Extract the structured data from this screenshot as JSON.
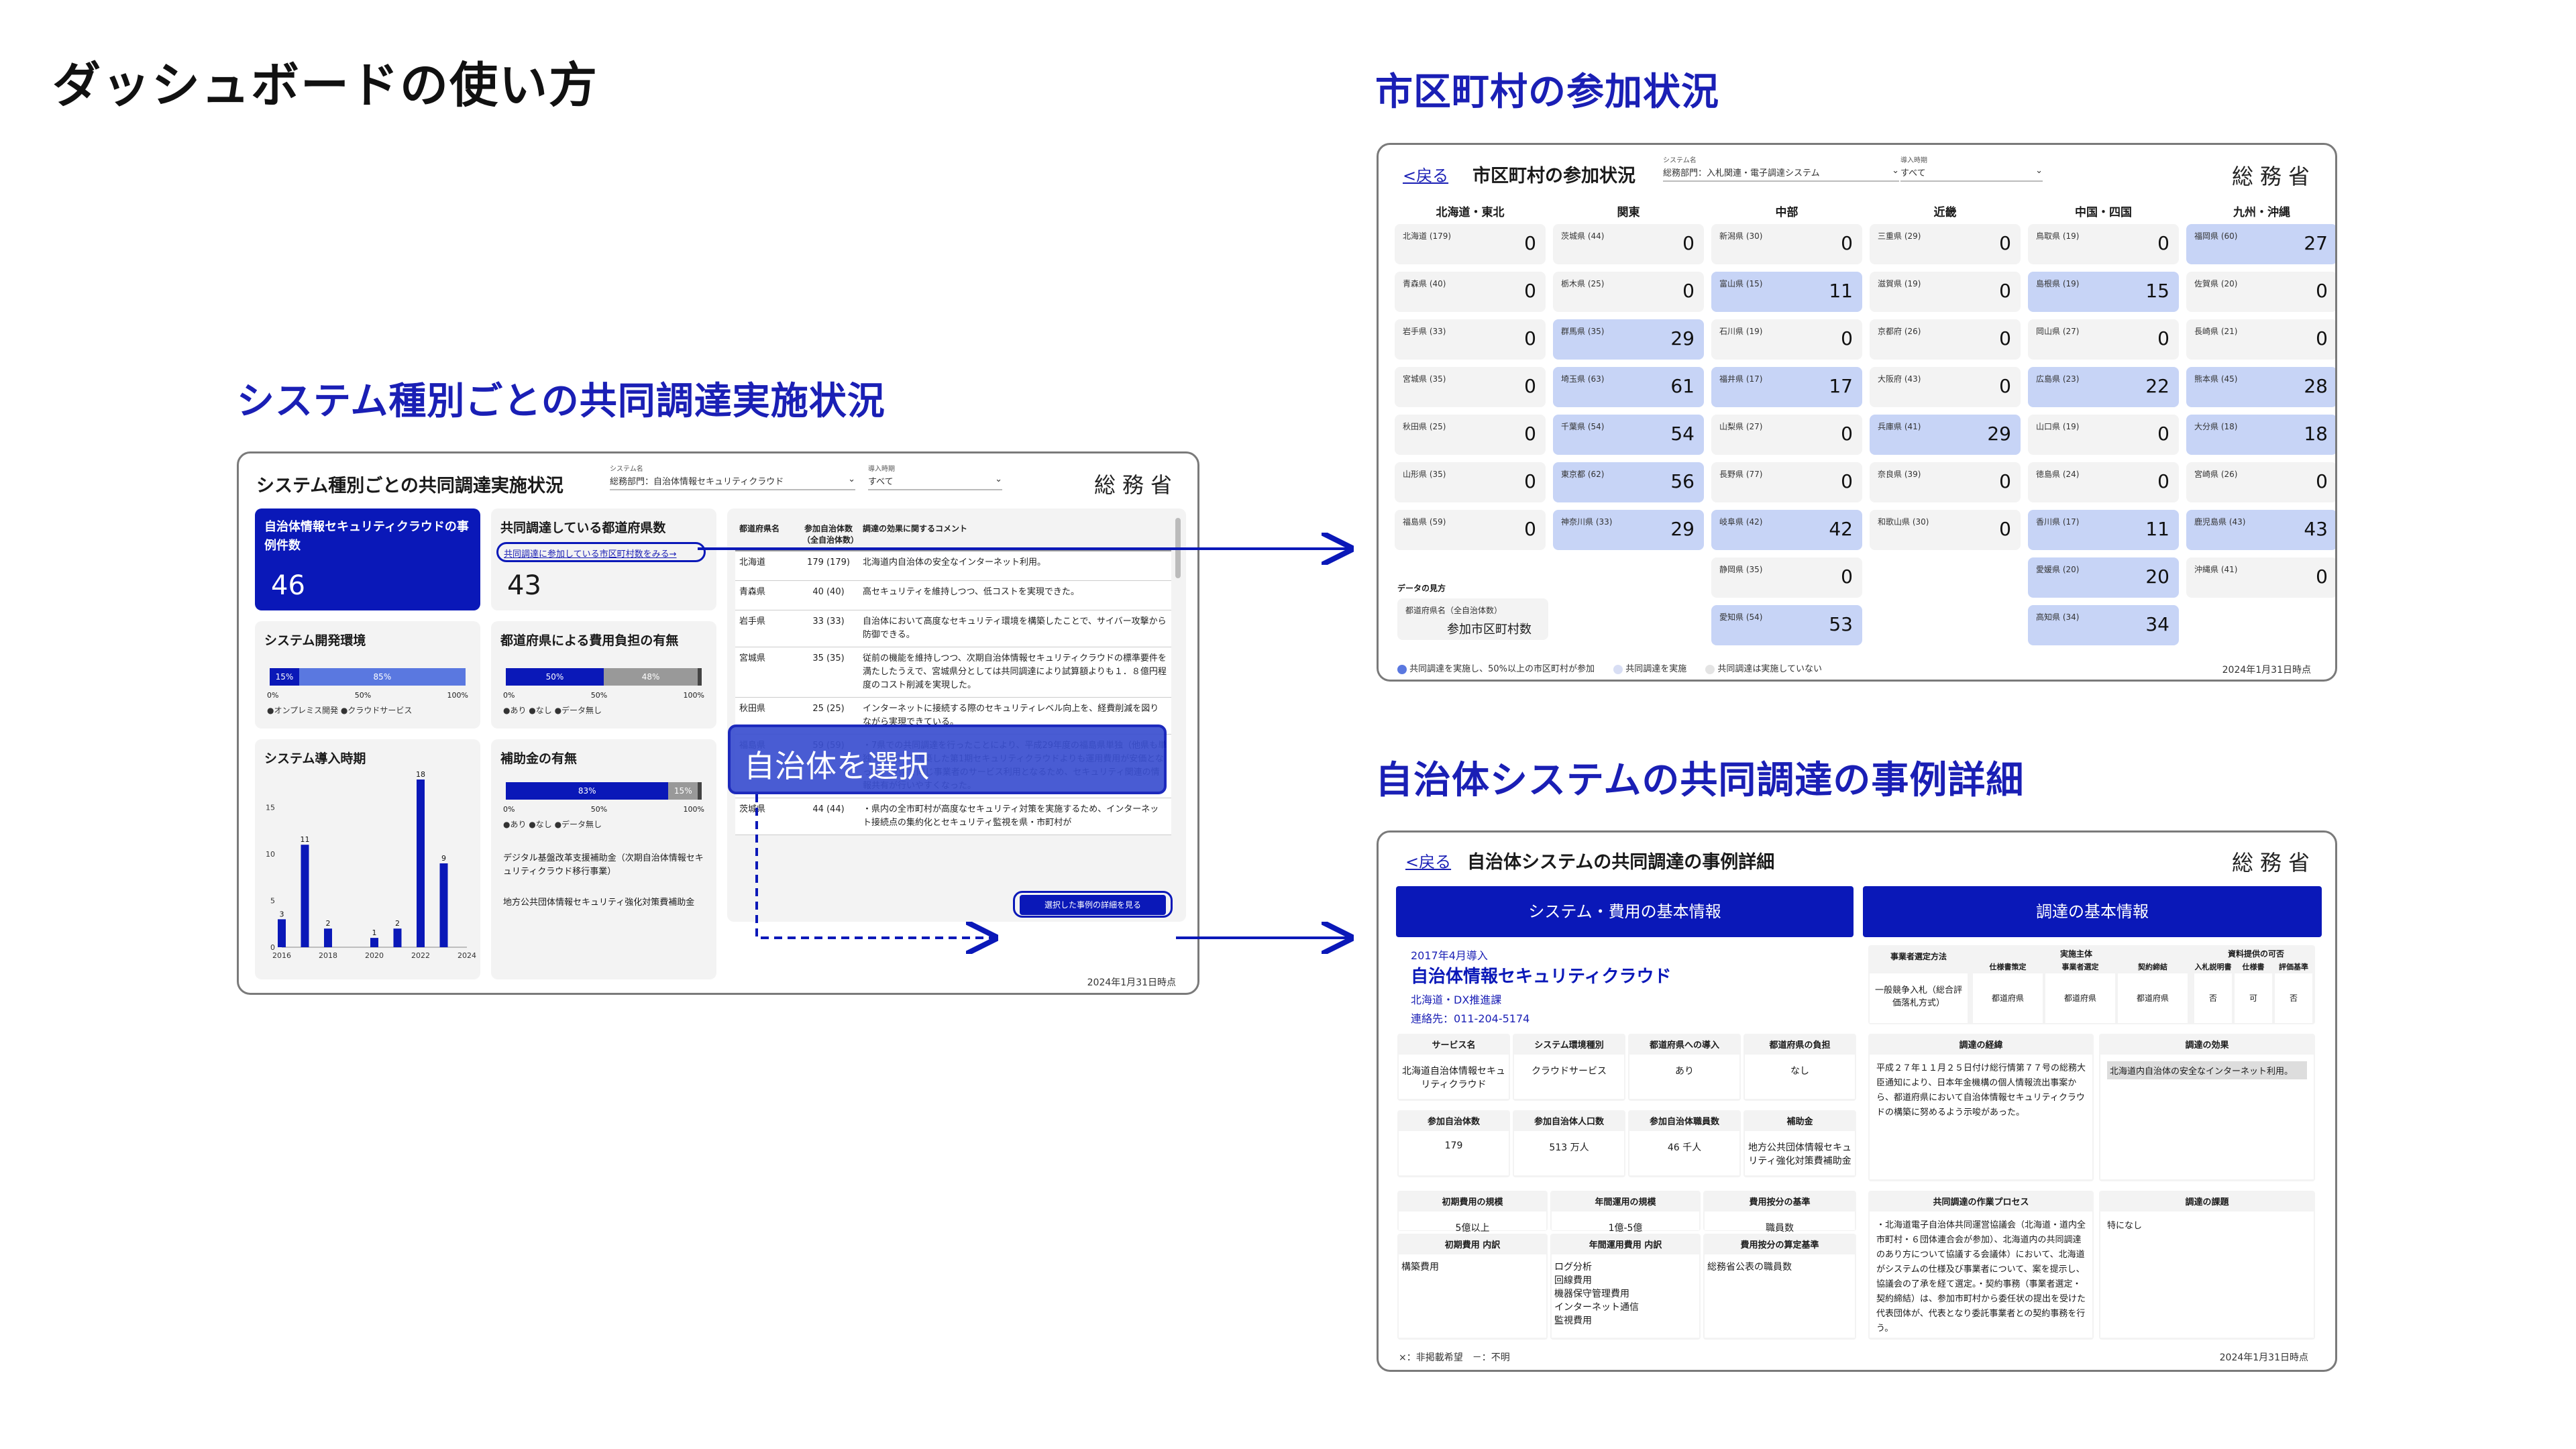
{
  "page_title": "ダッシュボードの使い方",
  "section_participation": "市区町村の参加状況",
  "section_system": "システム種別ごとの共同調達実施状況",
  "section_detail": "自治体システムの共同調達の事例詳細",
  "callout": "自治体を選択",
  "system_panel": {
    "title": "システム種別ごとの共同調達実施状況",
    "filter1": {
      "label": "システム名",
      "value": "総務部門：自治体情報セキュリティクラウド"
    },
    "filter2": {
      "label": "導入時期",
      "value": "すべて"
    },
    "ministry": "総務省",
    "kpi1": {
      "title": "自治体情報セキュリティクラウドの事例件数",
      "value": "46"
    },
    "kpi2": {
      "title": "共同調達している都道府県数",
      "link": "共同調達に参加している市区町村数をみる→",
      "value": "43"
    },
    "env": {
      "title": "システム開発環境",
      "seg1": "15%",
      "seg2": "85%",
      "ticks": [
        "0%",
        "50%",
        "100%"
      ],
      "legend": "●オンプレミス開発 ●クラウドサービス",
      "fraction_onprem": 0.15
    },
    "cost": {
      "title": "都道府県による費用負担の有無",
      "seg1": "50%",
      "seg2": "48%",
      "ticks": [
        "0%",
        "50%",
        "100%"
      ],
      "legend": "●あり ●なし ●データ無し",
      "fraction_yes": 0.5,
      "fraction_no": 0.48
    },
    "subsidy": {
      "title": "補助金の有無",
      "seg1": "83%",
      "seg2": "15%",
      "ticks": [
        "0%",
        "50%",
        "100%"
      ],
      "legend": "●あり ●なし ●データ無し",
      "fraction_yes": 0.83,
      "fraction_no": 0.15,
      "note1": "デジタル基盤改革支援補助金（次期自治体情報セキュリティクラウド移行事業）",
      "note2": "地方公共団体情報セキュリティ強化対策費補助金"
    },
    "timeline": {
      "title": "システム導入時期"
    },
    "table_header": {
      "pref": "都道府県名",
      "count": "参加自治体数（全自治体数）",
      "comment": "調達の効果に関するコメント"
    },
    "table_rows": [
      {
        "pref": "北海道",
        "count": "179 (179)",
        "comment": "北海道内自治体の安全なインターネット利用。"
      },
      {
        "pref": "青森県",
        "count": "40 (40)",
        "comment": "高セキュリティを維持しつつ、低コストを実現できた。"
      },
      {
        "pref": "岩手県",
        "count": "33 (33)",
        "comment": "自治体において高度なセキュリティ環境を構築したことで、サイバー攻撃から防御できる。"
      },
      {
        "pref": "宮城県",
        "count": "35 (35)",
        "comment": "従前の機能を維持しつつ、次期自治体情報セキュリティクラウドの標準要件を満たしたうえで、宮城県分としては共同調達により試算額よりも１．８億円程度のコスト削減を実現した。"
      },
      {
        "pref": "秋田県",
        "count": "25 (25)",
        "comment": "インターネットに接続する際のセキュリティレベル向上を、経費削減を図りながら実現できている。"
      },
      {
        "pref": "福島県",
        "count": "59 (59)",
        "comment": "・7県での共同調達を行ったことにより、平成29年度の福島県単独（他県も単独で実施）で構築した第1期セキュリティクラウドよりも運用費用が安価となった。・7県で同じ事業者のサービス利用となるため、セキュリティ関連の情報共有が行いやすくなった。"
      },
      {
        "pref": "茨城県",
        "count": "44 (44)",
        "comment": "・県内の全市町村が高度なセキュリティ対策を実施するため、インターネット接続点の集約化とセキュリティ監視を県・市町村が"
      }
    ],
    "detail_button": "選択した事例の詳細を見る",
    "footer": "2024年1月31日時点"
  },
  "chart_data": {
    "type": "bar",
    "title": "システム導入時期",
    "x": [
      2016,
      2017,
      2018,
      2019,
      2020,
      2021,
      2022,
      2023
    ],
    "values": [
      3,
      11,
      2,
      0,
      1,
      2,
      18,
      9
    ],
    "x_ticks": [
      "2016",
      "2018",
      "2020",
      "2022",
      "2024"
    ],
    "y_ticks": [
      "0",
      "5",
      "10",
      "15"
    ],
    "ylim": [
      0,
      18
    ],
    "color": "#0a18b8"
  },
  "participation_panel": {
    "back": "<戻る",
    "title": "市区町村の参加状況",
    "filter1": {
      "label": "システム名",
      "value": "総務部門：入札関連・電子調達システム"
    },
    "filter2": {
      "label": "導入時期",
      "value": "すべて"
    },
    "ministry": "総務省",
    "regions": [
      {
        "name": "北海道・東北",
        "cells": [
          {
            "n": "北海道 (179)",
            "v": "0"
          },
          {
            "n": "青森県 (40)",
            "v": "0"
          },
          {
            "n": "岩手県 (33)",
            "v": "0"
          },
          {
            "n": "宮城県 (35)",
            "v": "0"
          },
          {
            "n": "秋田県 (25)",
            "v": "0"
          },
          {
            "n": "山形県 (35)",
            "v": "0"
          },
          {
            "n": "福島県 (59)",
            "v": "0"
          }
        ]
      },
      {
        "name": "関東",
        "cells": [
          {
            "n": "茨城県 (44)",
            "v": "0"
          },
          {
            "n": "栃木県 (25)",
            "v": "0"
          },
          {
            "n": "群馬県 (35)",
            "v": "29",
            "h": true
          },
          {
            "n": "埼玉県 (63)",
            "v": "61",
            "h": true
          },
          {
            "n": "千葉県 (54)",
            "v": "54",
            "h": true
          },
          {
            "n": "東京都 (62)",
            "v": "56",
            "h": true
          },
          {
            "n": "神奈川県 (33)",
            "v": "29",
            "h": true
          }
        ]
      },
      {
        "name": "中部",
        "cells": [
          {
            "n": "新潟県 (30)",
            "v": "0"
          },
          {
            "n": "富山県 (15)",
            "v": "11",
            "h": true
          },
          {
            "n": "石川県 (19)",
            "v": "0"
          },
          {
            "n": "福井県 (17)",
            "v": "17",
            "h": true
          },
          {
            "n": "山梨県 (27)",
            "v": "0"
          },
          {
            "n": "長野県 (77)",
            "v": "0"
          },
          {
            "n": "岐阜県 (42)",
            "v": "42",
            "h": true
          },
          {
            "n": "静岡県 (35)",
            "v": "0"
          },
          {
            "n": "愛知県 (54)",
            "v": "53",
            "h": true
          }
        ]
      },
      {
        "name": "近畿",
        "cells": [
          {
            "n": "三重県 (29)",
            "v": "0"
          },
          {
            "n": "滋賀県 (19)",
            "v": "0"
          },
          {
            "n": "京都府 (26)",
            "v": "0"
          },
          {
            "n": "大阪府 (43)",
            "v": "0"
          },
          {
            "n": "兵庫県 (41)",
            "v": "29",
            "h": true
          },
          {
            "n": "奈良県 (39)",
            "v": "0"
          },
          {
            "n": "和歌山県 (30)",
            "v": "0"
          }
        ]
      },
      {
        "name": "中国・四国",
        "cells": [
          {
            "n": "鳥取県 (19)",
            "v": "0"
          },
          {
            "n": "島根県 (19)",
            "v": "15",
            "h": true
          },
          {
            "n": "岡山県 (27)",
            "v": "0"
          },
          {
            "n": "広島県 (23)",
            "v": "22",
            "h": true
          },
          {
            "n": "山口県 (19)",
            "v": "0"
          },
          {
            "n": "徳島県 (24)",
            "v": "0"
          },
          {
            "n": "香川県 (17)",
            "v": "11",
            "h": true
          },
          {
            "n": "愛媛県 (20)",
            "v": "20",
            "h": true
          },
          {
            "n": "高知県 (34)",
            "v": "34",
            "h": true
          }
        ]
      },
      {
        "name": "九州・沖縄",
        "cells": [
          {
            "n": "福岡県 (60)",
            "v": "27",
            "h": true
          },
          {
            "n": "佐賀県 (20)",
            "v": "0"
          },
          {
            "n": "長崎県 (21)",
            "v": "0"
          },
          {
            "n": "熊本県 (45)",
            "v": "28",
            "h": true
          },
          {
            "n": "大分県 (18)",
            "v": "18",
            "h": true
          },
          {
            "n": "宮崎県 (26)",
            "v": "0"
          },
          {
            "n": "鹿児島県 (43)",
            "v": "43",
            "h": true
          },
          {
            "n": "沖縄県 (41)",
            "v": "0"
          }
        ]
      }
    ],
    "guide_title": "データの見方",
    "guide_label": "都道府県名（全自治体数）",
    "guide_value": "参加市区町村数",
    "legend": [
      "共同調達を実施し、50%以上の市区町村が参加",
      "共同調達を実施",
      "共同調達は実施していない"
    ],
    "legend_colors": [
      "#5a78e0",
      "#d8def4",
      "#e4e4e4"
    ],
    "footer": "2024年1月31日時点"
  },
  "detail_panel": {
    "back": "<戻る",
    "title": "自治体システムの共同調達の事例詳細",
    "ministry": "総務省",
    "head_left": "システム・費用の基本情報",
    "head_right": "調達の基本情報",
    "intro_date": "2017年4月導入",
    "system_name": "自治体情報セキュリティクラウド",
    "department": "北海道・DX推進課",
    "contact": "連絡先：011-204-5174",
    "grid1": [
      {
        "h": "サービス名",
        "v": "北海道自治体情報セキュリティクラウド"
      },
      {
        "h": "システム環境種別",
        "v": "クラウドサービス"
      },
      {
        "h": "都道府県への導入",
        "v": "あり"
      },
      {
        "h": "都道府県の負担",
        "v": "なし"
      }
    ],
    "grid2": [
      {
        "h": "参加自治体数",
        "v": "179"
      },
      {
        "h": "参加自治体人口数",
        "v": "513 万人"
      },
      {
        "h": "参加自治体職員数",
        "v": "46 千人"
      },
      {
        "h": "補助金",
        "v": "地方公共団体情報セキュリティ強化対策費補助金"
      }
    ],
    "grid3": [
      {
        "h": "初期費用の規模",
        "v": "5億以上"
      },
      {
        "h": "年間運用の規模",
        "v": "1億-5億"
      },
      {
        "h": "費用按分の基準",
        "v": "職員数"
      }
    ],
    "grid4": [
      {
        "h": "初期費用 内訳",
        "v": "構築費用"
      },
      {
        "h": "年間運用費用 内訳",
        "v": "ログ分析\n回線費用\n機器保守管理費用\nインターネット通信\n監視費用"
      },
      {
        "h": "費用按分の算定基準",
        "v": "総務省公表の職員数"
      }
    ],
    "proc_method_h": "事業者選定方法",
    "proc_method_v": "一般競争入札（総合評価落札方式）",
    "proc_actor_h": "実施主体",
    "proc_actor_cols": [
      "仕様書策定",
      "事業者選定",
      "契約締結"
    ],
    "proc_actor_vals": [
      "都道府県",
      "都道府県",
      "都道府県"
    ],
    "proc_docs_h": "資料提供の可否",
    "proc_docs_cols": [
      "入札説明書",
      "仕様書",
      "評価基準"
    ],
    "proc_docs_vals": [
      "否",
      "可",
      "否"
    ],
    "circumstances_h": "調達の経緯",
    "circumstances_v": "平成２７年１１月２５日付け総行情第７７号の総務大臣通知により、日本年金機構の個人情報流出事案から、都道府県において自治体情報セキュリティクラウドの構築に努めるよう示唆があった。",
    "effect_h": "調達の効果",
    "effect_v": "北海道内自治体の安全なインターネット利用。",
    "process_h": "共同調達の作業プロセス",
    "process_v": "・北海道電子自治体共同運営協議会（北海道・道内全市町村・６団体連合会が参加）、北海道内の共同調達のあり方について協議する会議体）において、北海道がシステムの仕様及び事業者について、案を提示し、協議会の了承を経て選定。・契約事務（事業者選定・契約締結）は、参加市町村から委任状の提出を受けた代表団体が、代表となり委託事業者との契約事務を行う。",
    "issues_h": "調達の課題",
    "issues_v": "特になし",
    "legend": "×：非掲載希望　－：不明",
    "footer": "2024年1月31日時点"
  }
}
